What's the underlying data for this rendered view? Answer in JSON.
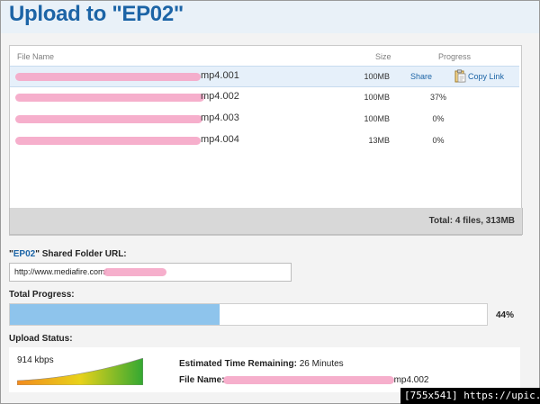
{
  "title": "Upload to \"EP02\"",
  "table": {
    "headers": {
      "file_name": "File Name",
      "size": "Size",
      "progress": "Progress"
    },
    "rows": [
      {
        "name_suffix": "mp4.001",
        "size": "100MB",
        "progress": "",
        "share": "Share",
        "copy_link": "Copy Link"
      },
      {
        "name_suffix": "mp4.002",
        "size": "100MB",
        "progress": "37%"
      },
      {
        "name_suffix": "mp4.003",
        "size": "100MB",
        "progress": "0%"
      },
      {
        "name_suffix": "mp4.004",
        "size": "13MB",
        "progress": "0%"
      }
    ],
    "total": "Total: 4 files, 313MB"
  },
  "shared_folder": {
    "quote_open": "\"",
    "folder": "EP02",
    "label_rest": "\" Shared Folder URL:",
    "url": "http://www.mediafire.com/"
  },
  "total_progress": {
    "label": "Total Progress:",
    "percent": 44,
    "percent_text": "44%"
  },
  "upload_status": {
    "label": "Upload Status:",
    "speed": "914 kbps",
    "eta_label": "Estimated Time Remaining:",
    "eta_value": "26 Minutes",
    "file_label": "File Name:",
    "file_suffix": "mp4.002"
  },
  "watermark": "[755x541] https://upic.me/",
  "colors": {
    "accent": "#1c64a6",
    "progress_fill": "#8ec4ec",
    "redaction": "#f5a8c8"
  },
  "icons": {
    "copy": "clipboard-icon"
  }
}
